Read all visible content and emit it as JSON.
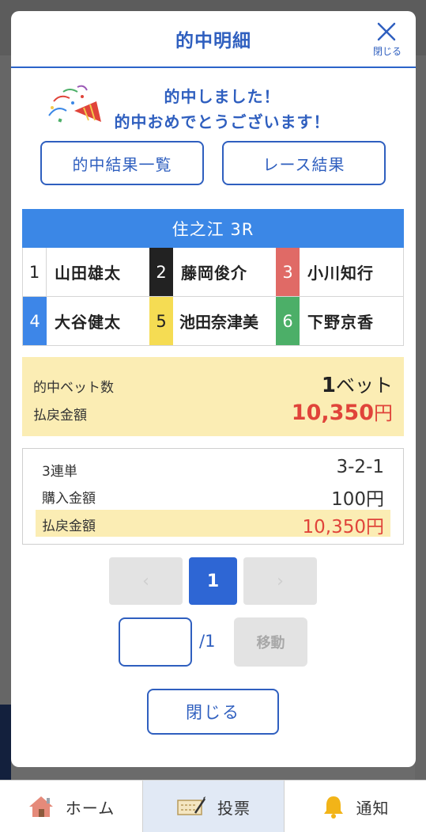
{
  "modal": {
    "title": "的中明細",
    "close_label": "閉じる"
  },
  "congrats": {
    "line1": "的中しました！",
    "line2": "的中おめでとうございます！"
  },
  "buttons": {
    "hit_list": "的中結果一覧",
    "race_result": "レース結果"
  },
  "race": {
    "title": "住之江 3R",
    "riders": [
      {
        "num": "1",
        "name": "山田雄太",
        "color": "#ffffff",
        "text_color": "#222222"
      },
      {
        "num": "2",
        "name": "藤岡俊介",
        "color": "#222222",
        "text_color": "#ffffff"
      },
      {
        "num": "3",
        "name": "小川知行",
        "color": "#e06a66",
        "text_color": "#ffffff"
      },
      {
        "num": "4",
        "name": "大谷健太",
        "color": "#3d86e8",
        "text_color": "#ffffff"
      },
      {
        "num": "5",
        "name": "池田奈津美",
        "color": "#f5dc53",
        "text_color": "#222222"
      },
      {
        "num": "6",
        "name": "下野京香",
        "color": "#4caf68",
        "text_color": "#ffffff"
      }
    ]
  },
  "summary": {
    "hit_bets_label": "的中ベット数",
    "hit_bets_count": "1",
    "hit_bets_unit": "ベット",
    "payout_label": "払戻金額",
    "payout_value": "10,350",
    "payout_unit": "円"
  },
  "detail": {
    "bet_type_label": "3連単",
    "bet_type_value": "3-2-1",
    "purchase_label": "購入金額",
    "purchase_value": "100円",
    "payout_label": "払戻金額",
    "payout_value": "10,350円"
  },
  "pagination": {
    "prev": "‹",
    "current": "1",
    "next": "›",
    "total": "/1",
    "move_label": "移動"
  },
  "close_button": "閉じる",
  "tabbar": {
    "home": "ホーム",
    "vote": "投票",
    "notice": "通知"
  },
  "colors": {
    "accent": "#2f5fbf",
    "race_bar": "#3b87e6",
    "payout_red": "#e0443a",
    "highlight": "#fbedb4"
  }
}
